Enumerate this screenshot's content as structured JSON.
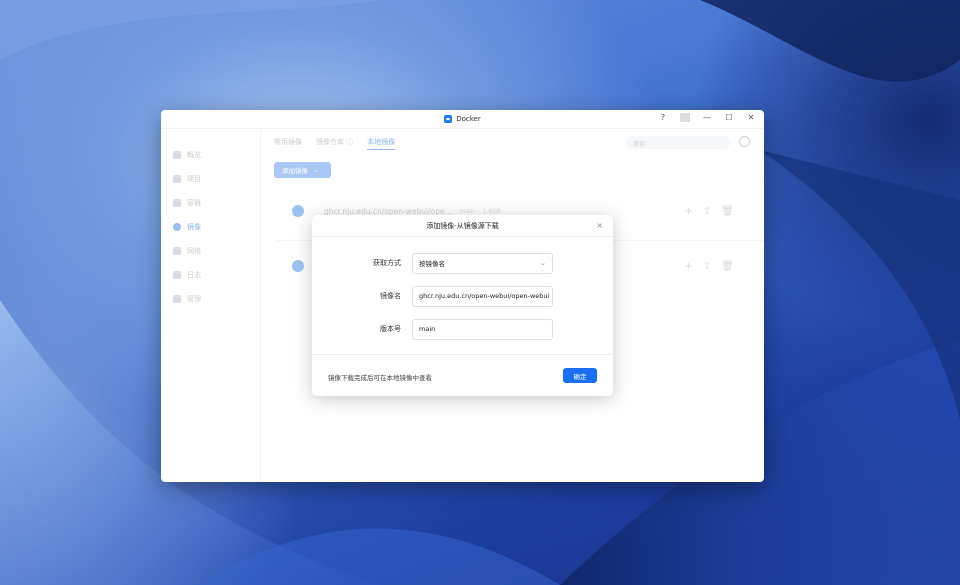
{
  "window": {
    "title": "Docker",
    "controls": {
      "help": "?",
      "minimize": "—",
      "maximize": "☐",
      "close": "✕"
    }
  },
  "sidebar": {
    "items": [
      {
        "label": "概览",
        "icon": "overview-icon"
      },
      {
        "label": "项目",
        "icon": "project-icon"
      },
      {
        "label": "容器",
        "icon": "container-icon"
      },
      {
        "label": "镜像",
        "icon": "image-icon",
        "active": true
      },
      {
        "label": "网络",
        "icon": "network-icon"
      },
      {
        "label": "日志",
        "icon": "log-icon"
      },
      {
        "label": "管理",
        "icon": "manage-icon"
      }
    ]
  },
  "main": {
    "tabs": [
      {
        "label": "常用镜像"
      },
      {
        "label": "镜像仓库 ⓘ"
      },
      {
        "label": "本地镜像",
        "active": true
      }
    ],
    "search_placeholder": "搜索",
    "add_image_button": "添加镜像",
    "add_image_chevron": "⌄",
    "image_rows": [
      {
        "name": "ghcr.nju.edu.cn/open-webui/ope...",
        "tag": "main",
        "size": "1.6GB"
      },
      {
        "name": "",
        "tag": "",
        "size": ""
      }
    ],
    "row_actions": {
      "add": "+",
      "export": "⇪",
      "delete": "🗑"
    }
  },
  "dialog": {
    "title": "添加镜像-从镜像源下载",
    "close": "×",
    "fields": [
      {
        "label": "获取方式",
        "value": "按镜像名",
        "type": "select"
      },
      {
        "label": "镜像名",
        "value": "ghcr.nju.edu.cn/open-webui/open-webui",
        "type": "text"
      },
      {
        "label": "版本号",
        "value": "main",
        "type": "text"
      }
    ],
    "note": "镜像下载完成后可在本地镜像中查看",
    "confirm_button": "确定"
  }
}
